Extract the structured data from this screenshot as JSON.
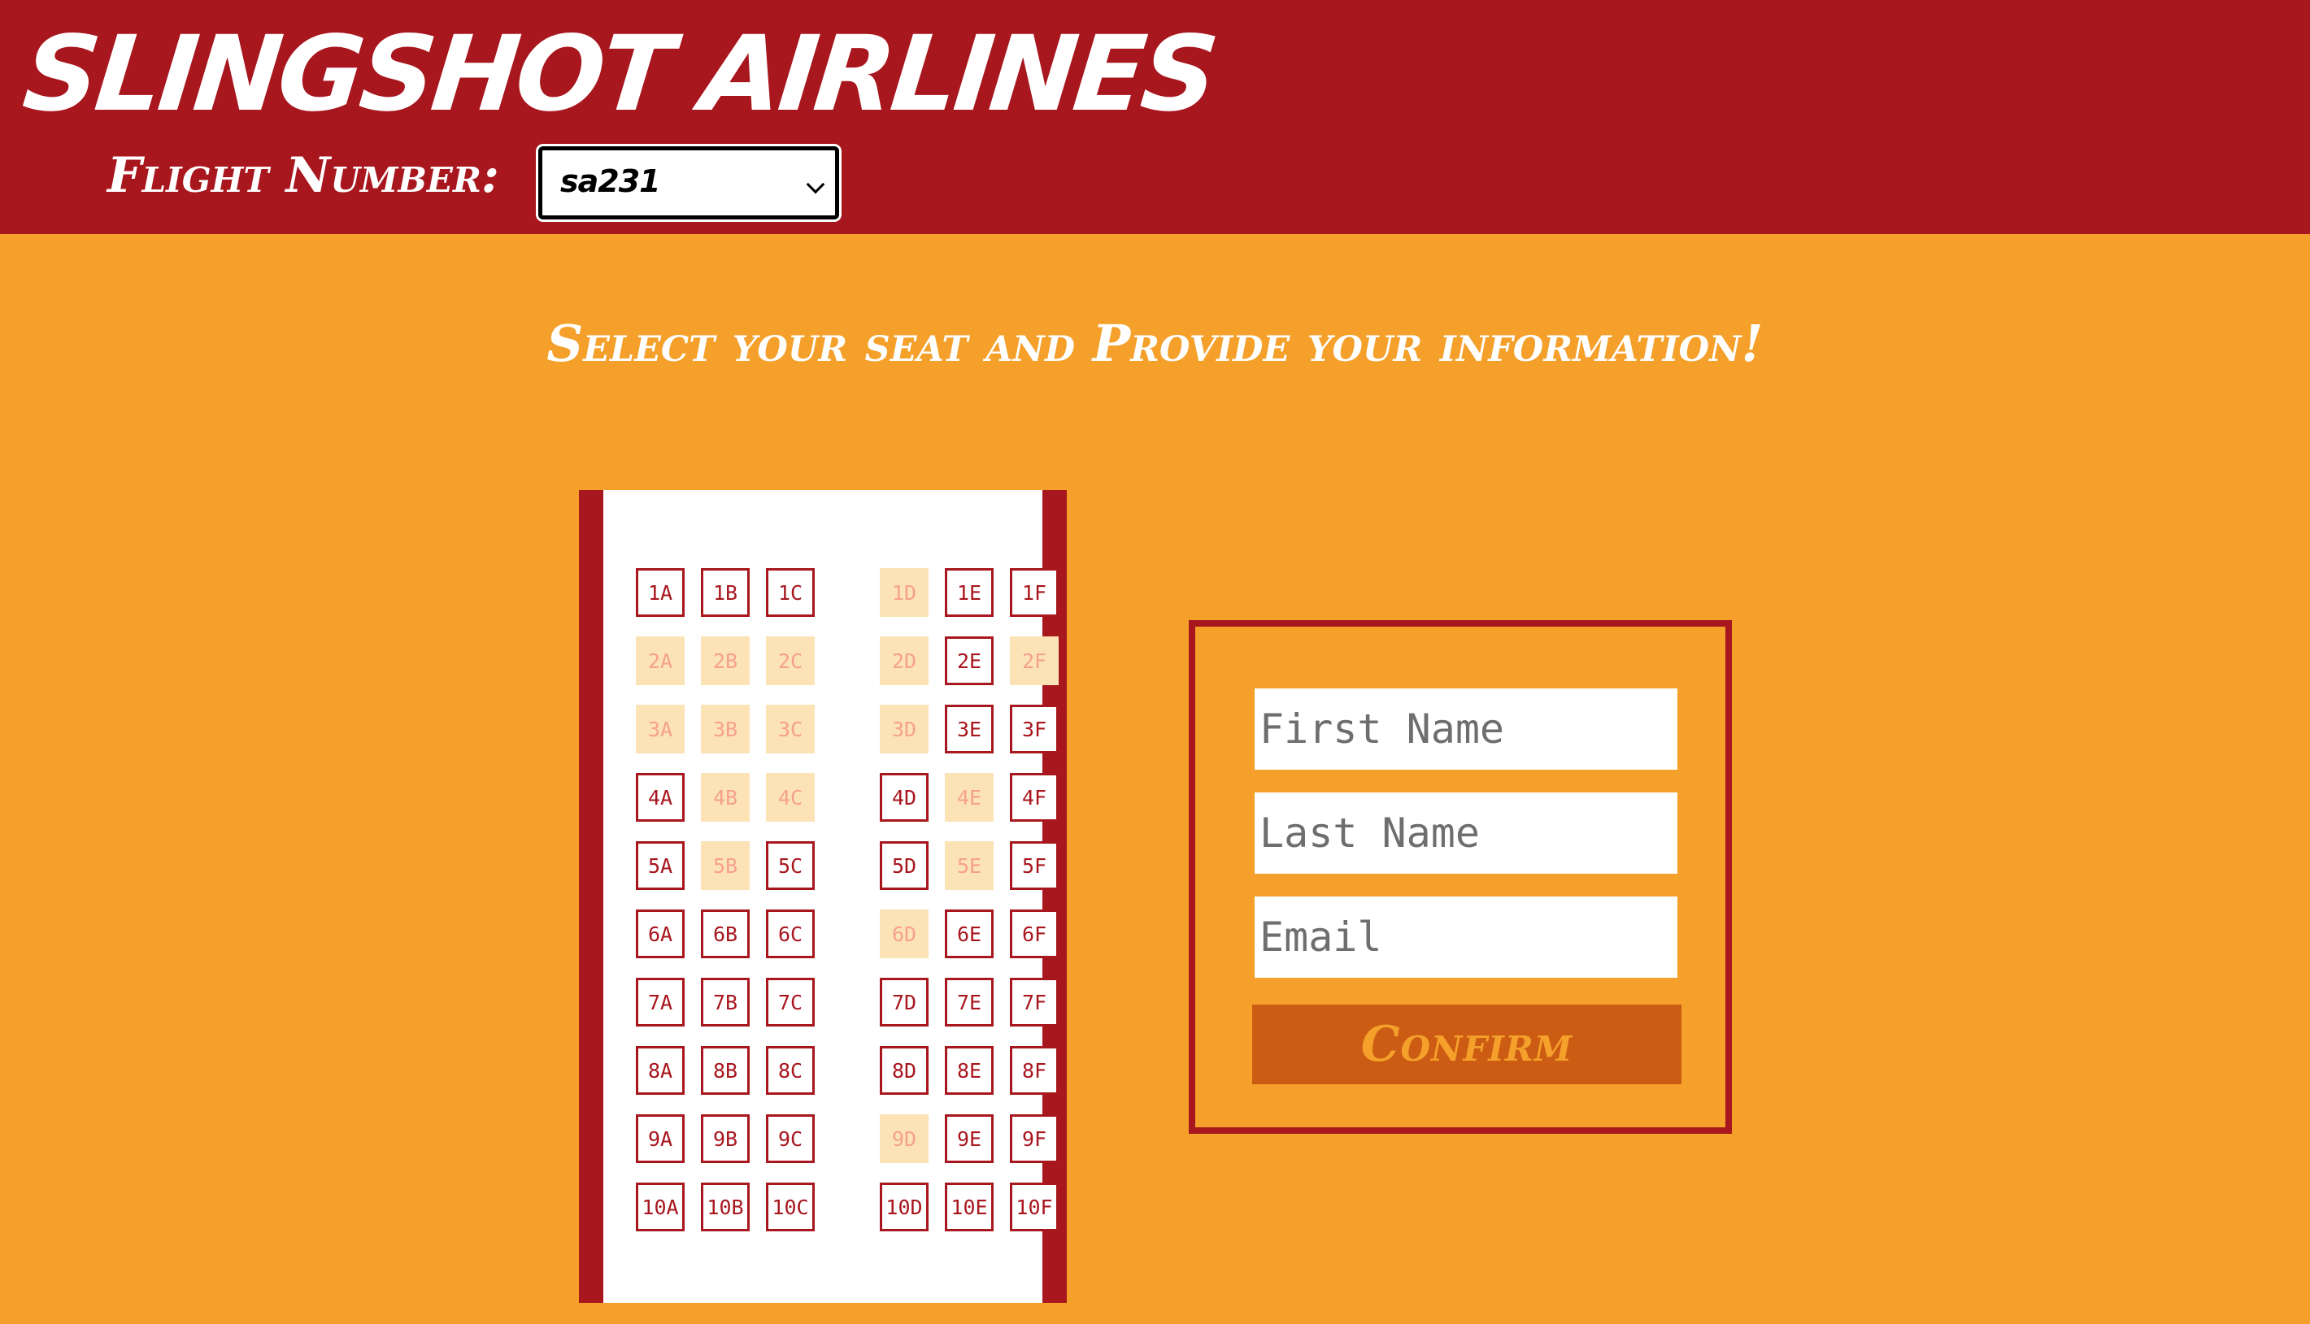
{
  "header": {
    "title": "SLINGSHOT AIRLINES",
    "flight_label": "Flight Number:",
    "flight_value": "sa231"
  },
  "main": {
    "subtitle": "Select your seat and Provide your information!"
  },
  "seat_map": {
    "columns": [
      "A",
      "B",
      "C",
      "D",
      "E",
      "F"
    ],
    "rows": [
      1,
      2,
      3,
      4,
      5,
      6,
      7,
      8,
      9,
      10
    ],
    "unavailable": [
      "1D",
      "2A",
      "2B",
      "2C",
      "2D",
      "2F",
      "3A",
      "3B",
      "3C",
      "3D",
      "4B",
      "4C",
      "4E",
      "5B",
      "5E",
      "6D",
      "9D"
    ]
  },
  "form": {
    "first_name_placeholder": "First Name",
    "last_name_placeholder": "Last Name",
    "email_placeholder": "Email",
    "confirm_label": "Confirm"
  },
  "colors": {
    "header_bg": "#A8161E",
    "page_bg": "#F4A02A",
    "seat_available_border": "#A8161E",
    "seat_unavailable_bg": "#FCE3B6",
    "confirm_bg": "#CC5C14"
  }
}
